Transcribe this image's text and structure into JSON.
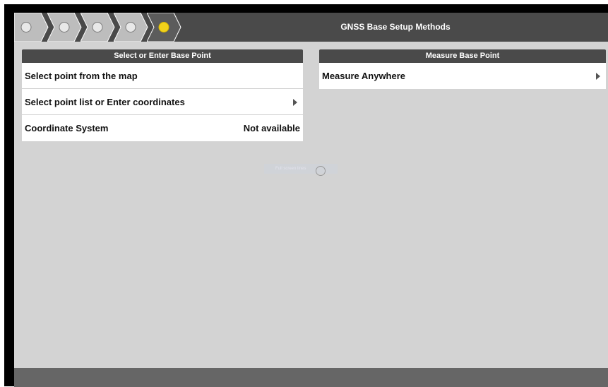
{
  "topbar": {
    "title": "GNSS Base Setup Methods",
    "steps": [
      {
        "state": "inactive"
      },
      {
        "state": "inactive"
      },
      {
        "state": "inactive"
      },
      {
        "state": "inactive"
      },
      {
        "state": "active",
        "color": "#f2d21b"
      }
    ]
  },
  "left_panel": {
    "header": "Select or Enter Base Point",
    "rows": [
      {
        "label": "Select point from the map"
      },
      {
        "label": "Select point list or Enter coordinates"
      },
      {
        "label": "Coordinate System",
        "value": "Not available"
      }
    ]
  },
  "right_panel": {
    "header": "Measure Base Point",
    "rows": [
      {
        "label": "Measure Anywhere"
      }
    ]
  },
  "overlay": {
    "ghost_text": "Full screen lines"
  },
  "colors": {
    "bar": "#4a4a4a",
    "background": "#d3d3d3",
    "active_step": "#f2d21b"
  }
}
